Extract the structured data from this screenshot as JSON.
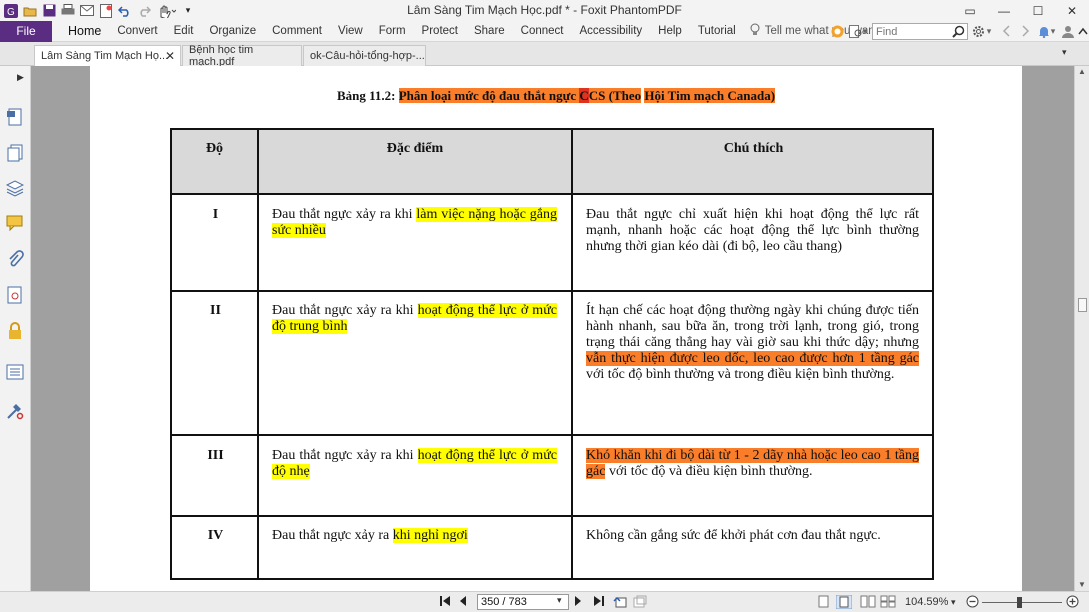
{
  "window": {
    "title": "Lâm Sàng Tim Mạch Học.pdf * - Foxit PhantomPDF"
  },
  "ribbon": {
    "file_label": "File",
    "tabs": [
      "Home",
      "Convert",
      "Edit",
      "Organize",
      "Comment",
      "View",
      "Form",
      "Protect",
      "Share",
      "Connect",
      "Accessibility",
      "Help",
      "Tutorial"
    ],
    "tell_me": "Tell me what you want to do...",
    "find_placeholder": "Find"
  },
  "doc_tabs": [
    "Lâm Sàng Tim Mạch Họ...",
    "Bệnh học tim mạch.pdf",
    "ok-Câu-hỏi-tổng-hợp-..."
  ],
  "document": {
    "caption_prefix": "Bảng 11.2: ",
    "caption_part1": "Phân loại mức độ đau thắt ngực ",
    "caption_part2": "C",
    "caption_part3": "CS (Theo",
    "caption_part4": " ",
    "caption_part5": "Hội Tim mạch Canada)",
    "headers": [
      "Độ",
      "Đặc điểm",
      "Chú thích"
    ],
    "rows": [
      {
        "level": "I",
        "feature_plain": "Đau thắt ngực xảy ra khi ",
        "feature_hl": "làm việc nặng hoặc gắng sức nhiều",
        "note_plain": "Đau thắt ngực chỉ xuất hiện khi hoạt động thể lực rất mạnh, nhanh hoặc các hoạt động thể lực bình thường nhưng thời gian kéo dài (đi bộ, leo cầu thang)",
        "note_hl": "",
        "note_after": ""
      },
      {
        "level": "II",
        "feature_plain": "Đau thắt ngực xảy ra khi ",
        "feature_hl": "hoạt động thể lực ở mức độ trung bình",
        "note_plain": "Ít hạn chế các hoạt động thường ngày khi chúng được tiến hành nhanh, sau bữa ăn, trong trời lạnh, trong gió, trong trạng thái căng thẳng hay vài giờ sau khi thức dậy; nhưng ",
        "note_hl": "vẫn thực hiện được leo dốc, leo cao được hơn 1 tầng gác",
        "note_after": " với tốc độ bình thường và trong điều kiện bình thường."
      },
      {
        "level": "III",
        "feature_plain": "Đau thắt ngực xảy ra khi ",
        "feature_hl": "hoạt động thể lực ở mức độ nhẹ",
        "note_plain": "",
        "note_hl": "Khó khăn khi đi bộ dài từ 1 - 2 dãy nhà hoặc leo cao 1 tầng gác",
        "note_after": " với tốc độ và điều kiện bình thường."
      },
      {
        "level": "IV",
        "feature_plain": "Đau thắt ngực xảy ra ",
        "feature_hl": "khi nghỉ ngơi",
        "note_plain": "Không cần gắng sức để khởi phát cơn đau thắt ngực.",
        "note_hl": "",
        "note_after": ""
      }
    ]
  },
  "status": {
    "page": "350 / 783",
    "zoom": "104.59%"
  },
  "colors": {
    "file_tab": "#5a2d82",
    "highlight_orange": "#fa7d29",
    "highlight_yellow": "#ffff00",
    "highlight_red": "#e0331f"
  }
}
